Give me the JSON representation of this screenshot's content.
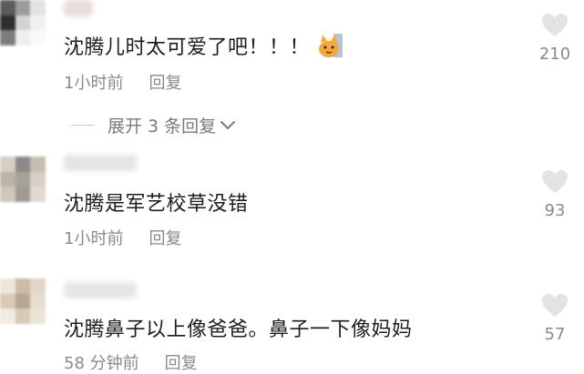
{
  "comments": [
    {
      "text": "沈腾儿时太可爱了吧！！！",
      "time": "1小时前",
      "reply_label": "回复",
      "like_count": "210",
      "emoji_icon": "cat-sticker-icon",
      "avatar_colors": [
        "#5b5b5b",
        "#9c9c9c",
        "#e3e3e3",
        "#2e2e2e",
        "#d3d3d3",
        "#f1f1f1",
        "#7d7d7d",
        "#eeeeee",
        "#fafafa"
      ],
      "username_color": "#eadcd8"
    },
    {
      "text": "沈腾是军艺校草没错",
      "time": "1小时前",
      "reply_label": "回复",
      "like_count": "93",
      "avatar_colors": [
        "#d8d0c6",
        "#8a8a8a",
        "#c7bdb0",
        "#bdb3a6",
        "#a9a29a",
        "#d6cfc5",
        "#cfc7bb",
        "#9e9a94",
        "#e0dad2"
      ],
      "username_color": "#e4e4e4"
    },
    {
      "text": "沈腾鼻子以上像爸爸。鼻子一下像妈妈",
      "time": "58 分钟前",
      "reply_label": "回复",
      "like_count": "57",
      "avatar_colors": [
        "#efe5da",
        "#cbbba6",
        "#e3d6c6",
        "#d9c9b5",
        "#b8a68f",
        "#e6dccf",
        "#f2eadf",
        "#d8cab8",
        "#ece3d7"
      ],
      "username_color": "#e6e6e6"
    }
  ],
  "expand_replies": {
    "label": "展开 3 条回复"
  },
  "icons": {
    "like": "heart-icon",
    "chevron": "chevron-down-icon"
  },
  "colors": {
    "heart": "#e3e3e3",
    "meta_text": "#8a8a8a",
    "body_text": "#1d1d1d"
  }
}
